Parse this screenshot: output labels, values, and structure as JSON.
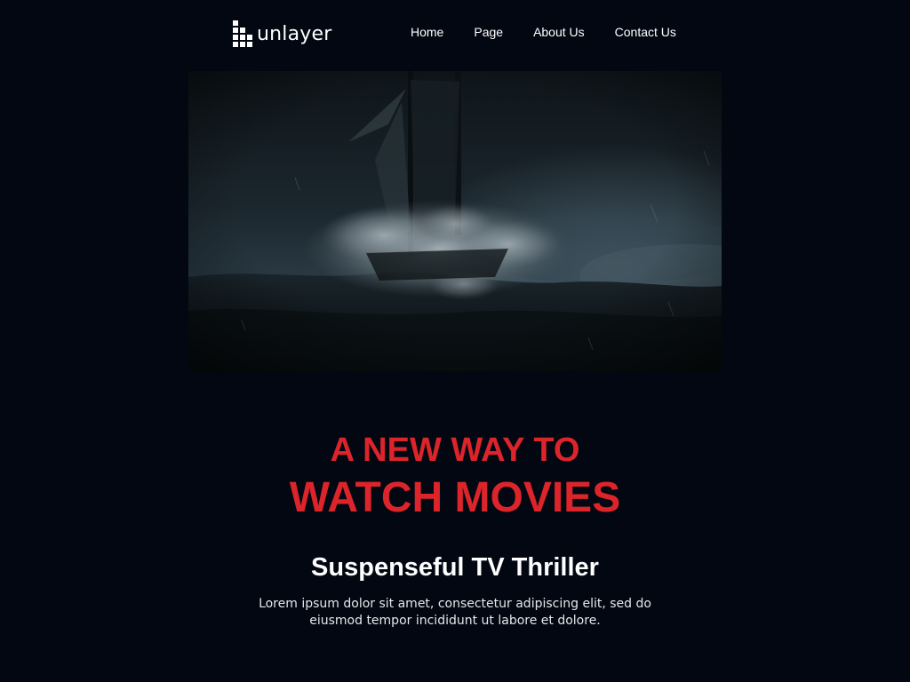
{
  "header": {
    "logo": {
      "icon": "unlayer-logo-icon",
      "text": "unlayer"
    },
    "nav": [
      {
        "label": "Home"
      },
      {
        "label": "Page"
      },
      {
        "label": "About Us"
      },
      {
        "label": "Contact Us"
      }
    ]
  },
  "hero": {
    "image": "stormy-sea-sailing-ship-image"
  },
  "content": {
    "headline_line1": "A NEW WAY TO",
    "headline_line2": "WATCH MOVIES",
    "subtitle": "Suspenseful TV Thriller",
    "body": "Lorem ipsum dolor sit amet, consectetur adipiscing elit, sed do eiusmod tempor incididunt ut labore et dolore."
  },
  "colors": {
    "background": "#030712",
    "accent": "#dc242b",
    "text": "#ffffff"
  }
}
